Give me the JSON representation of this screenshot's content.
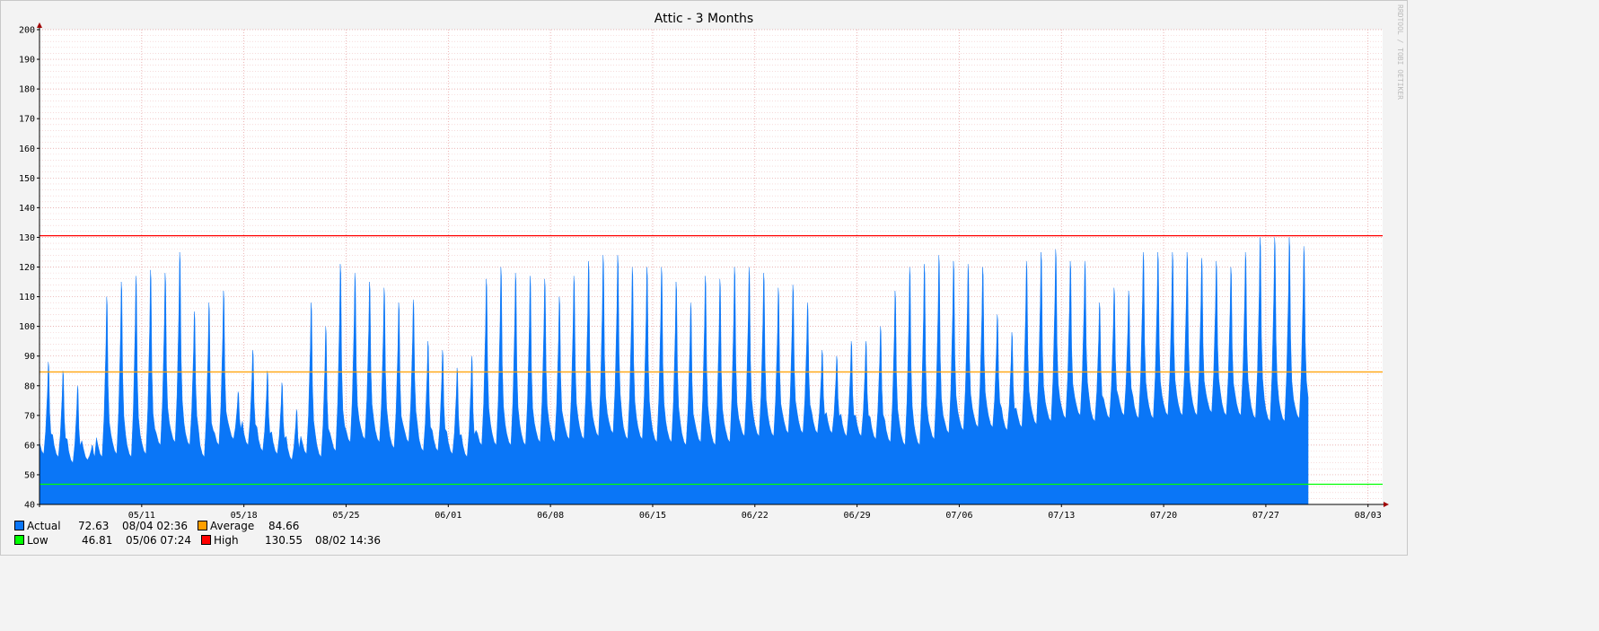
{
  "chart_data": {
    "type": "area",
    "title": "Attic - 3 Months",
    "watermark": "RRDTOOL / TOBI OETIKER",
    "xlabel": "",
    "ylabel": "",
    "ylim": [
      40,
      200
    ],
    "y_ticks": [
      "40",
      "50",
      "60",
      "70",
      "80",
      "90",
      "100",
      "110",
      "120",
      "130",
      "140",
      "150",
      "160",
      "170",
      "180",
      "190",
      "200"
    ],
    "x_range": [
      "2026-05-04",
      "2026-08-04"
    ],
    "x_ticks": [
      {
        "label": "05/11",
        "date": "2026-05-11"
      },
      {
        "label": "05/18",
        "date": "2026-05-18"
      },
      {
        "label": "05/25",
        "date": "2026-05-25"
      },
      {
        "label": "06/01",
        "date": "2026-06-01"
      },
      {
        "label": "06/08",
        "date": "2026-06-08"
      },
      {
        "label": "06/15",
        "date": "2026-06-15"
      },
      {
        "label": "06/22",
        "date": "2026-06-22"
      },
      {
        "label": "06/29",
        "date": "2026-06-29"
      },
      {
        "label": "07/06",
        "date": "2026-07-06"
      },
      {
        "label": "07/13",
        "date": "2026-07-13"
      },
      {
        "label": "07/20",
        "date": "2026-07-20"
      },
      {
        "label": "07/27",
        "date": "2026-07-27"
      },
      {
        "label": "08/03",
        "date": "2026-08-03"
      }
    ],
    "grid": true,
    "series": [
      {
        "name": "Actual",
        "color": "#0a76f7",
        "daily_peaks": [
          88,
          85,
          80,
          60,
          110,
          115,
          117,
          119,
          118,
          125,
          105,
          108,
          112,
          78,
          92,
          85,
          81,
          72,
          108,
          100,
          121,
          118,
          115,
          113,
          108,
          109,
          95,
          92,
          86,
          90,
          116,
          120,
          118,
          117,
          116,
          110,
          117,
          122,
          124,
          124,
          120,
          120,
          120,
          115,
          108,
          117,
          116,
          120,
          120,
          118,
          113,
          114,
          108,
          92,
          90,
          95,
          95,
          100,
          112,
          120,
          121,
          124,
          122,
          121,
          120,
          104,
          98,
          122,
          125,
          126,
          122,
          122,
          108,
          113,
          112,
          125,
          125,
          125,
          125,
          123,
          122,
          120,
          125,
          130,
          130,
          130,
          127
        ],
        "daily_lows": [
          57,
          56,
          54,
          55,
          56,
          57,
          56,
          57,
          60,
          61,
          60,
          56,
          60,
          62,
          60,
          58,
          57,
          55,
          57,
          56,
          58,
          61,
          62,
          61,
          59,
          61,
          58,
          58,
          57,
          56,
          60,
          60,
          60,
          60,
          61,
          61,
          62,
          62,
          63,
          64,
          62,
          62,
          61,
          61,
          60,
          61,
          60,
          61,
          63,
          63,
          63,
          64,
          64,
          64,
          64,
          63,
          63,
          62,
          61,
          60,
          60,
          62,
          64,
          65,
          66,
          66,
          65,
          66,
          67,
          68,
          69,
          70,
          68,
          69,
          70,
          69,
          69,
          70,
          70,
          70,
          71,
          70,
          70,
          69,
          68,
          68,
          69
        ]
      },
      {
        "name": "Average",
        "color": "#ff9f00",
        "value": 84.66
      },
      {
        "name": "Low",
        "color": "#00ff00",
        "value": 46.81
      },
      {
        "name": "High",
        "color": "#ff0000",
        "value": 130.55
      }
    ]
  },
  "legend": {
    "actual": {
      "label": "Actual",
      "value": "72.63",
      "time": "08/04 02:36",
      "color": "#0a76f7"
    },
    "average": {
      "label": "Average",
      "value": "84.66",
      "color": "#ff9f00"
    },
    "low": {
      "label": "Low",
      "value": "46.81",
      "time": "05/06 07:24",
      "color": "#00ff00"
    },
    "high": {
      "label": "High",
      "value": "130.55",
      "time": "08/02 14:36",
      "color": "#ff0000"
    }
  }
}
